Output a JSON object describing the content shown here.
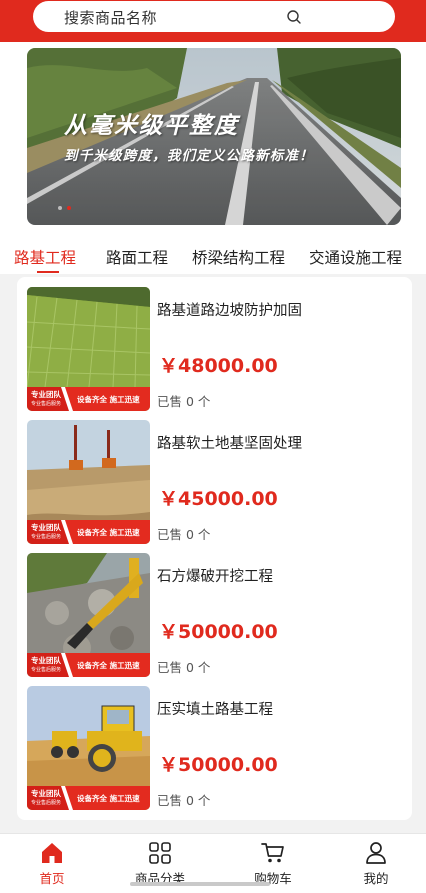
{
  "search": {
    "placeholder": "搜索商品名称",
    "icon": "search-icon"
  },
  "banner": {
    "title": "从毫米级平整度",
    "subtitle": "到千米级跨度，我们定义公路新标准！",
    "slide_count": 2,
    "active_slide": 1
  },
  "tabs": [
    {
      "label": "路基工程",
      "active": true
    },
    {
      "label": "路面工程",
      "active": false
    },
    {
      "label": "桥梁结构工程",
      "active": false
    },
    {
      "label": "交通设施工程",
      "active": false
    }
  ],
  "badge": {
    "team_line1": "专业团队",
    "team_line2": "专业售后服务",
    "features": "设备齐全 施工迅速"
  },
  "products": [
    {
      "title": "路基道路边坡防护加固",
      "price": "￥48000.00",
      "sold": "已售 0 个",
      "image": "slope-reinforcement-photo"
    },
    {
      "title": "路基软土地基坚固处理",
      "price": "￥45000.00",
      "sold": "已售 0 个",
      "image": "soft-soil-drilling-photo"
    },
    {
      "title": "石方爆破开挖工程",
      "price": "￥50000.00",
      "sold": "已售 0 个",
      "image": "rock-excavation-photo"
    },
    {
      "title": "压实填土路基工程",
      "price": "￥50000.00",
      "sold": "已售 0 个",
      "image": "road-roller-photo"
    }
  ],
  "nav": [
    {
      "label": "首页",
      "icon": "home-icon",
      "active": true
    },
    {
      "label": "商品分类",
      "icon": "category-grid-icon",
      "active": false
    },
    {
      "label": "购物车",
      "icon": "cart-icon",
      "active": false
    },
    {
      "label": "我的",
      "icon": "user-icon",
      "active": false
    }
  ],
  "colors": {
    "accent": "#e02a1e",
    "background": "#f2f2f2",
    "price": "#e02a1e"
  }
}
